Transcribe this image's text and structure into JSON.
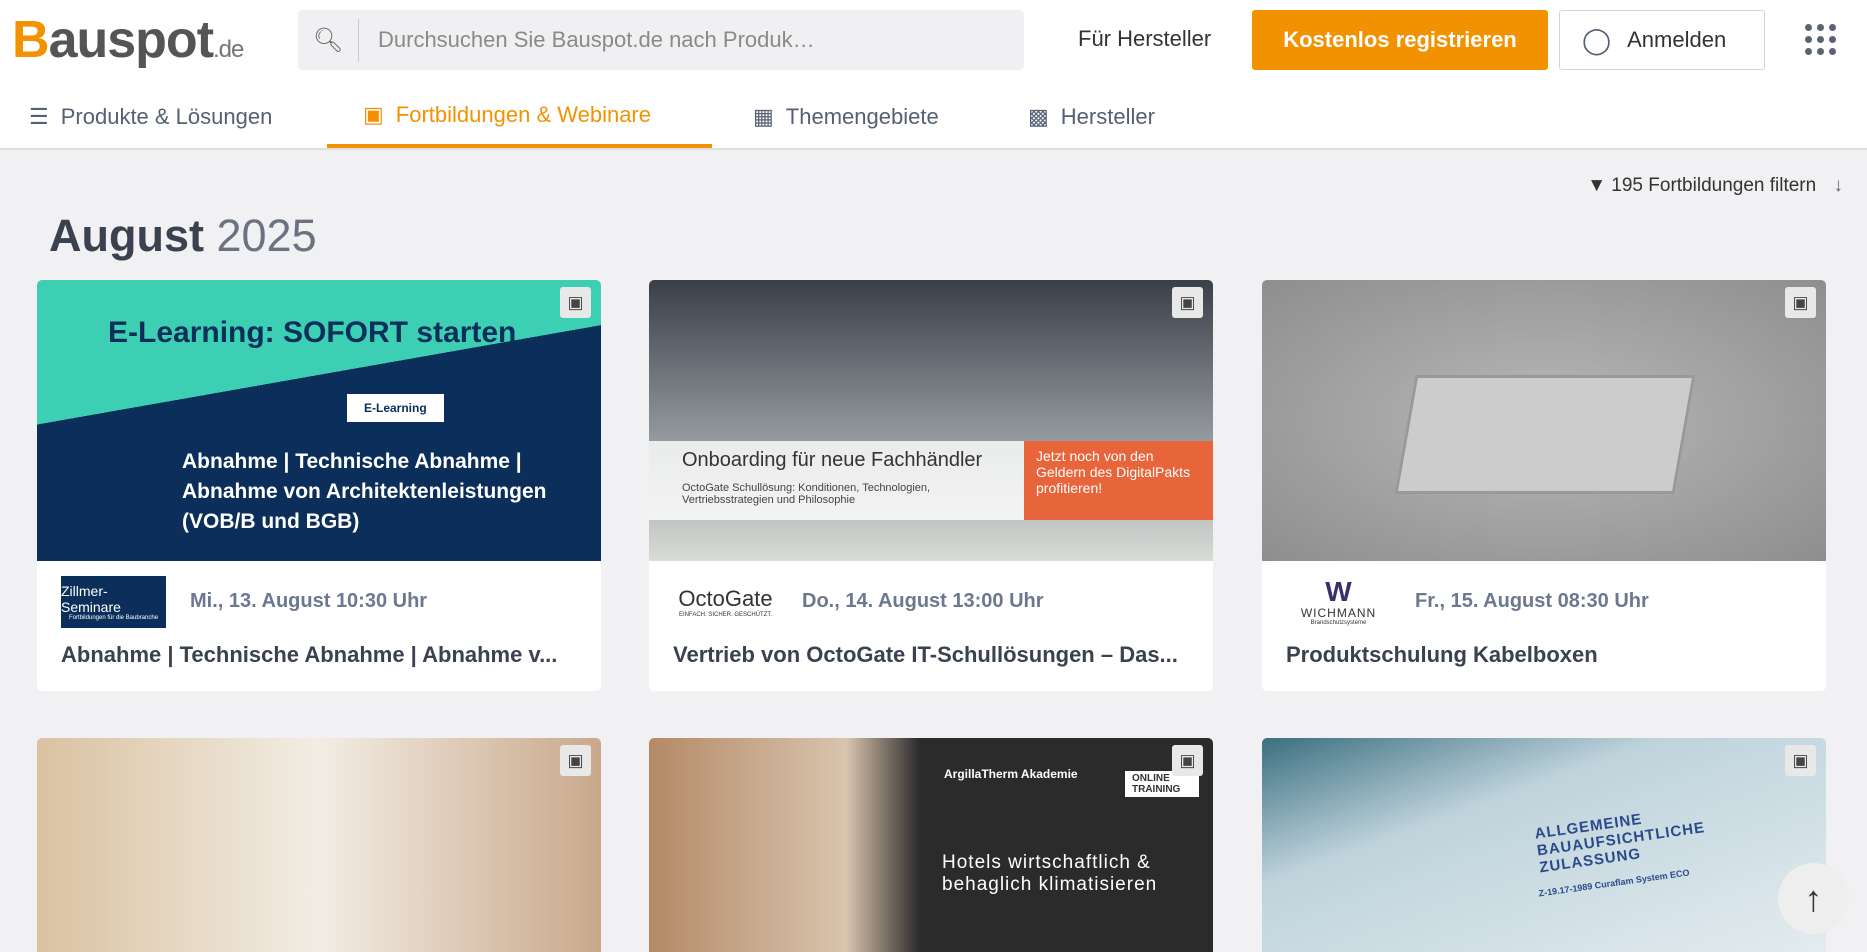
{
  "header": {
    "logo": "Bauspot",
    "logo_tld": ".de",
    "search_placeholder": "Durchsuchen Sie Bauspot.de nach Produk…",
    "manufacturer_link": "Für Hersteller",
    "register": "Kostenlos registrieren",
    "login": "Anmelden"
  },
  "nav": [
    {
      "label": "Produkte & Lösungen"
    },
    {
      "label": "Fortbildungen & Webinare"
    },
    {
      "label": "Themengebiete"
    },
    {
      "label": "Hersteller"
    }
  ],
  "filter": "195 Fortbildungen filtern",
  "month": {
    "name": "August",
    "year": "2025"
  },
  "cards": [
    {
      "image_heading": "E-Learning: SOFORT starten",
      "image_tag": "E-Learning",
      "image_text": "Abnahme | Technische Abnahme | Abnahme von Architektenleistungen (VOB/B und BGB)",
      "provider": "Zillmer-Seminare",
      "provider_sub": "Fortbildungen für die Baubranche",
      "date": "Mi., 13. August 10:30 Uhr",
      "title": "Abnahme | Technische Abnahme | Abnahme v..."
    },
    {
      "image_heading": "Onboarding für neue Fachhändler",
      "image_text": "OctoGate Schullösung: Konditionen, Technologien, Vertriebsstrategien und Philosophie",
      "image_promo": "Jetzt noch von den Geldern des DigitalPakts profitieren!",
      "provider": "OctoGate",
      "provider_sub": "EINFACH. SICHER. GESCHÜTZT.",
      "date": "Do., 14. August 13:00 Uhr",
      "title": "Vertrieb von OctoGate IT-Schullösungen – Das..."
    },
    {
      "provider": "WICHMANN",
      "provider_sub": "Brandschutzsysteme",
      "date": "Fr., 15. August 08:30 Uhr",
      "title": "Produktschulung Kabelboxen"
    },
    {},
    {
      "image_brand": "ArgillaTherm Akademie",
      "image_tag": "ONLINE TRAINING",
      "image_text": "Hotels wirtschaftlich & behaglich klimatisieren"
    },
    {
      "image_text": "ALLGEMEINE BAUAUFSICHTLICHE ZULASSUNG",
      "image_sub": "Z-19.17-1989 Curaflam System ECO"
    }
  ]
}
